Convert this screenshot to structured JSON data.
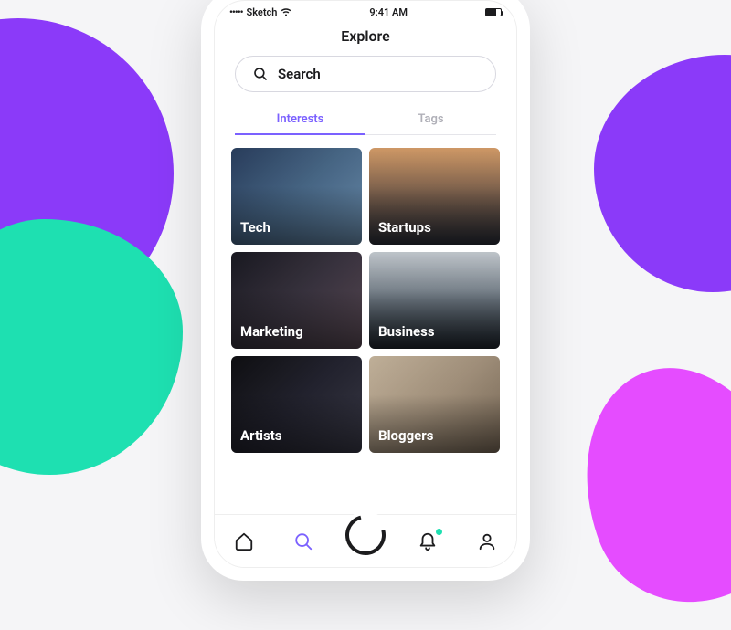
{
  "status": {
    "carrier": "Sketch",
    "time": "9:41 AM"
  },
  "header": {
    "title": "Explore"
  },
  "search": {
    "placeholder": "Search"
  },
  "tabs": {
    "interests": "Interests",
    "tags": "Tags"
  },
  "cards": {
    "tech": "Tech",
    "startups": "Startups",
    "marketing": "Marketing",
    "business": "Business",
    "artists": "Artists",
    "bloggers": "Bloggers"
  }
}
